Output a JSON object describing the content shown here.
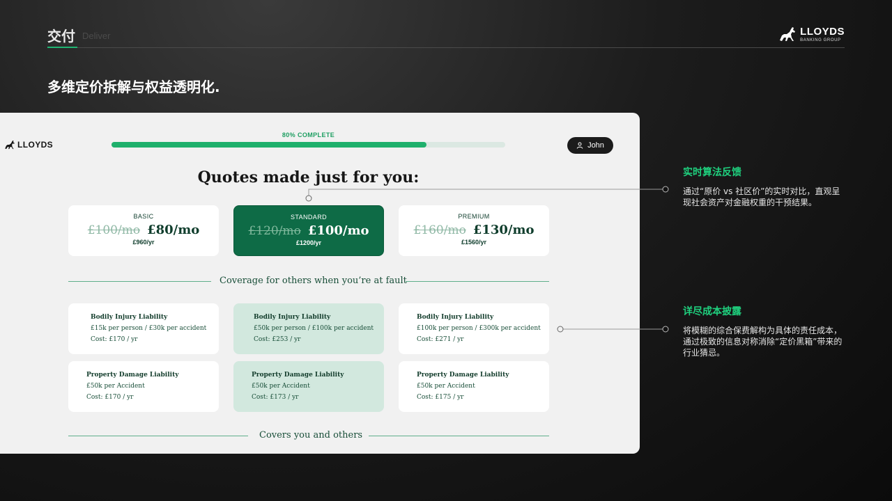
{
  "header": {
    "section_cn": "交付",
    "section_en": "Deliver",
    "brand_name": "LLOYDS",
    "brand_sub": "BANKING GROUP"
  },
  "slide_title": "多维定价拆解与权益透明化.",
  "mock": {
    "logo_text": "LLOYDS",
    "progress": {
      "label": "80% COMPLETE",
      "value": 0.8
    },
    "user_name": "John",
    "heading": "Quotes made just for you:",
    "plans": [
      {
        "name": "BASIC",
        "old_price": "£100/mo",
        "new_price": "£80/mo",
        "yearly": "£960/yr",
        "selected": false
      },
      {
        "name": "STANDARD",
        "old_price": "£120/mo",
        "new_price": "£100/mo",
        "yearly": "£1200/yr",
        "selected": true
      },
      {
        "name": "PREMIUM",
        "old_price": "£160/mo",
        "new_price": "£130/mo",
        "yearly": "£1560/yr",
        "selected": false
      }
    ],
    "coverage_label": "Coverage for others when you’re at fault",
    "bodily": [
      {
        "title": "Bodily Injury Liability",
        "line": "£15k per person / £30k per accident",
        "cost": "Cost: £170 / yr"
      },
      {
        "title": "Bodily Injury Liability",
        "line": "£50k per person / £100k per accident",
        "cost": "Cost: £253 / yr"
      },
      {
        "title": "Bodily Injury Liability",
        "line": "£100k per person / £300k per accident",
        "cost": "Cost: £271 / yr"
      }
    ],
    "property": [
      {
        "title": "Property Damage Liability",
        "line": "£50k per Accident",
        "cost": "Cost: £170 / yr"
      },
      {
        "title": "Property Damage Liability",
        "line": "£50k per Accident",
        "cost": "Cost: £173 / yr"
      },
      {
        "title": "Property Damage Liability",
        "line": "£50k per Accident",
        "cost": "Cost: £175 / yr"
      }
    ],
    "covers_label": "Covers you and others"
  },
  "callouts": [
    {
      "title": "实时算法反馈",
      "body": "通过“原价 vs 社区价”的实时对比，直观呈现社会资产对金融权重的干预结果。"
    },
    {
      "title": "详尽成本披露",
      "body": "将模糊的综合保费解构为具体的责任成本，通过极致的信息对称消除“定价黑箱”带来的行业猜忌。"
    }
  ],
  "colors": {
    "accent_green": "#1fd07e",
    "brand_green": "#0e6b46",
    "progress_green": "#1fb06c",
    "mint": "#d2e8de"
  },
  "icons": [
    "horse-logo-icon",
    "user-icon"
  ]
}
